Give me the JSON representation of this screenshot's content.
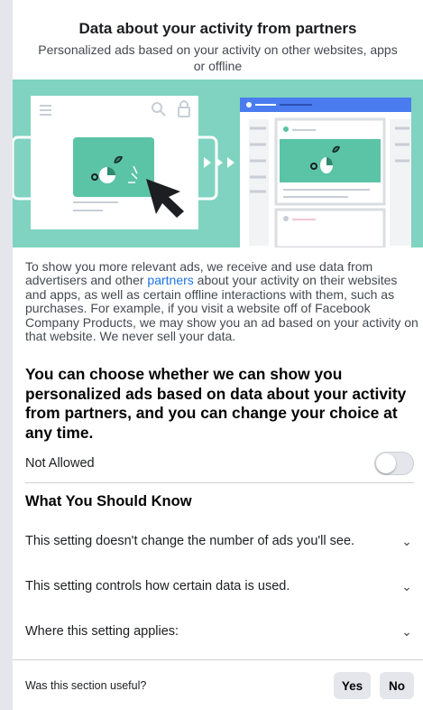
{
  "header": {
    "title": "Data about your activity from partners",
    "subtitle": "Personalized ads based on your activity on other websites, apps or offline"
  },
  "description": {
    "part1": "To show you more relevant ads, we receive and use data from advertisers and other ",
    "link": "partners",
    "part2": " about your activity on their websites and apps, as well as certain offline interactions with them, such as purchases. For example, if you visit a website off of Facebook Company Products, we may show you an ad based on your activity on that website. We never sell your data."
  },
  "choice_heading": "You can choose whether we can show you personalized ads based on data about your activity from partners, and you can change your choice at any time.",
  "setting": {
    "label": "Not Allowed",
    "enabled": false
  },
  "know": {
    "title": "What You Should Know",
    "items": [
      {
        "label": "This setting doesn't change the number of ads you'll see."
      },
      {
        "label": "This setting controls how certain data is used."
      },
      {
        "label": "Where this setting applies:"
      }
    ]
  },
  "footer": {
    "question": "Was this section useful?",
    "yes": "Yes",
    "no": "No"
  },
  "colors": {
    "accent": "#1b74e4",
    "hero_bg": "#7fd3c0",
    "illustration_blue": "#4a7cf0"
  }
}
